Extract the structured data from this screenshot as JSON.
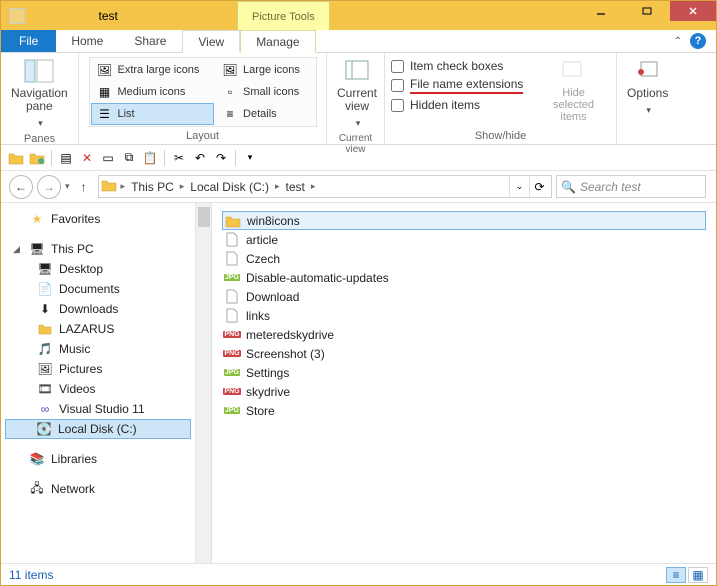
{
  "window": {
    "title": "test",
    "context_tab": "Picture Tools"
  },
  "tabs": {
    "file": "File",
    "home": "Home",
    "share": "Share",
    "view": "View",
    "manage": "Manage"
  },
  "ribbon": {
    "panes": {
      "nav_label": "Navigation\npane",
      "group": "Panes"
    },
    "layout": {
      "group": "Layout",
      "items": {
        "xl": "Extra large icons",
        "lg": "Large icons",
        "md": "Medium icons",
        "sm": "Small icons",
        "list": "List",
        "details": "Details"
      }
    },
    "current_view": {
      "label": "Current\nview",
      "group": "Current view"
    },
    "showhide": {
      "group": "Show/hide",
      "item_checkboxes": "Item check boxes",
      "file_ext": "File name extensions",
      "hidden": "Hidden items",
      "hide_selected": "Hide selected\nitems"
    },
    "options": "Options"
  },
  "breadcrumb": {
    "this_pc": "This PC",
    "c": "Local Disk (C:)",
    "folder": "test"
  },
  "search": {
    "placeholder": "Search test"
  },
  "nav": {
    "favorites": "Favorites",
    "this_pc": "This PC",
    "children": {
      "desktop": "Desktop",
      "documents": "Documents",
      "downloads": "Downloads",
      "lazarus": "LAZARUS",
      "music": "Music",
      "pictures": "Pictures",
      "videos": "Videos",
      "vs": "Visual Studio 11",
      "c": "Local Disk (C:)"
    },
    "libraries": "Libraries",
    "network": "Network"
  },
  "files": [
    {
      "name": "win8icons",
      "type": "folder"
    },
    {
      "name": "article",
      "type": "doc"
    },
    {
      "name": "Czech",
      "type": "doc"
    },
    {
      "name": "Disable-automatic-updates",
      "type": "jpg"
    },
    {
      "name": "Download",
      "type": "doc"
    },
    {
      "name": "links",
      "type": "doc"
    },
    {
      "name": "meteredskydrive",
      "type": "png"
    },
    {
      "name": "Screenshot (3)",
      "type": "png"
    },
    {
      "name": "Settings",
      "type": "jpg"
    },
    {
      "name": "skydrive",
      "type": "png"
    },
    {
      "name": "Store",
      "type": "jpg"
    }
  ],
  "status": {
    "count": "11 items"
  }
}
